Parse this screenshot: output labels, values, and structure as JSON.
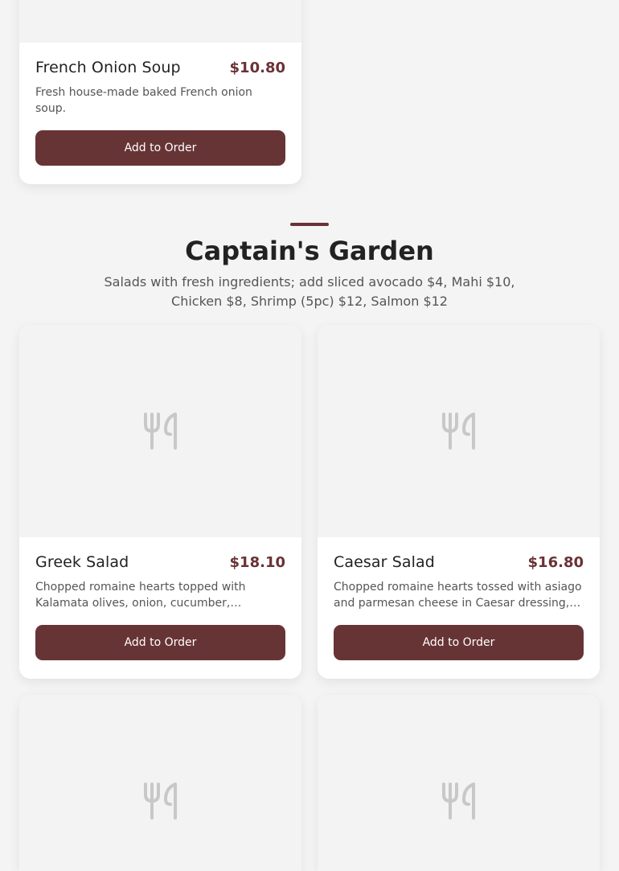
{
  "top_item": {
    "name": "French Onion Soup",
    "price": "$10.80",
    "description": "Fresh house-made baked French onion soup.",
    "button_label": "Add to Order"
  },
  "section": {
    "title": "Captain's Garden",
    "description": "Salads with fresh ingredients; add sliced avocado $4, Mahi $10, Chicken $8, Shrimp (5pc) $12, Salmon $12"
  },
  "items": [
    {
      "name": "Greek Salad",
      "price": "$18.10",
      "description": "Chopped romaine hearts topped with Kalamata olives, onion, cucumber, tomatoes and feta cheese.",
      "button_label": "Add to Order"
    },
    {
      "name": "Caesar Salad",
      "price": "$16.80",
      "description": "Chopped romaine hearts tossed with asiago and parmesan cheese in Caesar dressing, topped with croutons.",
      "button_label": "Add to Order"
    }
  ],
  "placeholder_icon": "utensils-icon"
}
